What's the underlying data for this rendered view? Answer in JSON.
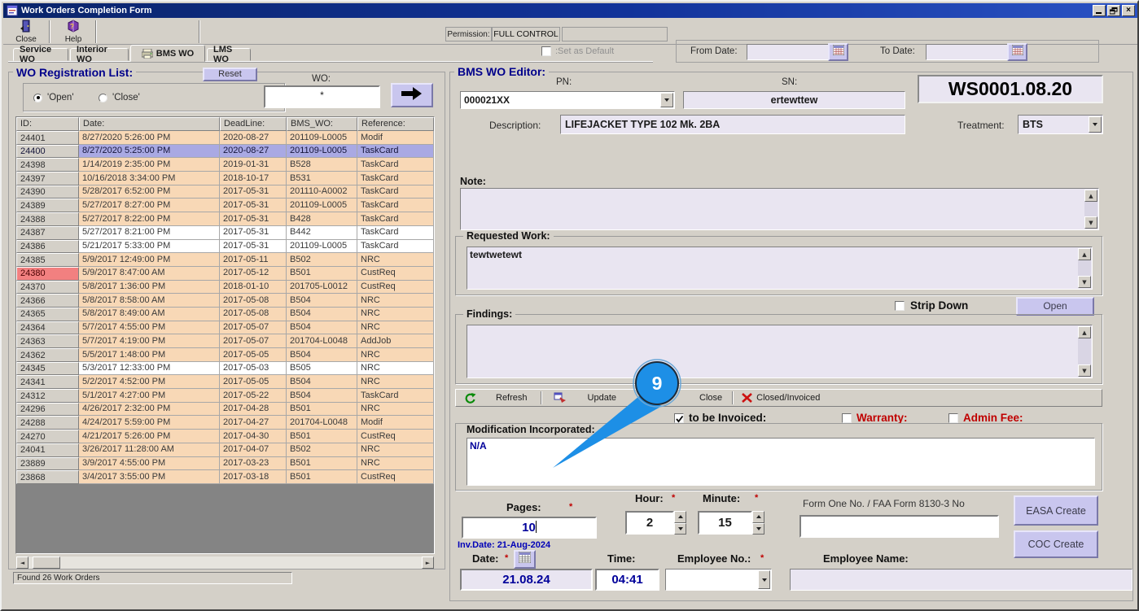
{
  "window": {
    "title": "Work Orders Completion Form",
    "minimize": "_",
    "restore": "",
    "close_x": "×"
  },
  "toolbar": {
    "close_label": "Close",
    "help_label": "Help",
    "permission_label": "Permission:",
    "permission_value": "FULL CONTROL"
  },
  "tabs": [
    {
      "label": "Service WO",
      "active": false
    },
    {
      "label": "Interior WO",
      "active": false
    },
    {
      "label": "BMS WO",
      "active": true
    },
    {
      "label": "LMS WO",
      "active": false
    }
  ],
  "set_as_default_label": ":Set as Default",
  "date_filter": {
    "from_label": "From Date:",
    "to_label": "To Date:",
    "from_value": "",
    "to_value": ""
  },
  "wo_list": {
    "title": "WO Registration List:",
    "reset_label": "Reset",
    "radio_open_label": "'Open'",
    "radio_close_label": "'Close'",
    "wo_label": "WO:",
    "wo_value": "*",
    "columns": [
      "ID:",
      "Date:",
      "DeadLine:",
      "BMS_WO:",
      "Reference:"
    ],
    "rows": [
      {
        "id": "24401",
        "date": "8/27/2020 5:26:00 PM",
        "deadline": "2020-08-27",
        "bms_wo": "201109-L0005",
        "reference": "Modif",
        "state": "peach"
      },
      {
        "id": "24400",
        "date": "8/27/2020 5:25:00 PM",
        "deadline": "2020-08-27",
        "bms_wo": "201109-L0005",
        "reference": "TaskCard",
        "state": "selected"
      },
      {
        "id": "24398",
        "date": "1/14/2019 2:35:00 PM",
        "deadline": "2019-01-31",
        "bms_wo": "B528",
        "reference": "TaskCard",
        "state": "peach"
      },
      {
        "id": "24397",
        "date": "10/16/2018 3:34:00 PM",
        "deadline": "2018-10-17",
        "bms_wo": "B531",
        "reference": "TaskCard",
        "state": "peach"
      },
      {
        "id": "24390",
        "date": "5/28/2017 6:52:00 PM",
        "deadline": "2017-05-31",
        "bms_wo": "201110-A0002",
        "reference": "TaskCard",
        "state": "peach"
      },
      {
        "id": "24389",
        "date": "5/27/2017 8:27:00 PM",
        "deadline": "2017-05-31",
        "bms_wo": "201109-L0005",
        "reference": "TaskCard",
        "state": "peach"
      },
      {
        "id": "24388",
        "date": "5/27/2017 8:22:00 PM",
        "deadline": "2017-05-31",
        "bms_wo": "B428",
        "reference": "TaskCard",
        "state": "peach"
      },
      {
        "id": "24387",
        "date": "5/27/2017 8:21:00 PM",
        "deadline": "2017-05-31",
        "bms_wo": "B442",
        "reference": "TaskCard",
        "state": "white"
      },
      {
        "id": "24386",
        "date": "5/21/2017 5:33:00 PM",
        "deadline": "2017-05-31",
        "bms_wo": "201109-L0005",
        "reference": "TaskCard",
        "state": "white"
      },
      {
        "id": "24385",
        "date": "5/9/2017 12:49:00 PM",
        "deadline": "2017-05-11",
        "bms_wo": "B502",
        "reference": "NRC",
        "state": "peach"
      },
      {
        "id": "24380",
        "date": "5/9/2017 8:47:00 AM",
        "deadline": "2017-05-12",
        "bms_wo": "B501",
        "reference": "CustReq",
        "state": "peach",
        "id_alert": true
      },
      {
        "id": "24370",
        "date": "5/8/2017 1:36:00 PM",
        "deadline": "2018-01-10",
        "bms_wo": "201705-L0012",
        "reference": "CustReq",
        "state": "peach"
      },
      {
        "id": "24366",
        "date": "5/8/2017 8:58:00 AM",
        "deadline": "2017-05-08",
        "bms_wo": "B504",
        "reference": "NRC",
        "state": "peach"
      },
      {
        "id": "24365",
        "date": "5/8/2017 8:49:00 AM",
        "deadline": "2017-05-08",
        "bms_wo": "B504",
        "reference": "NRC",
        "state": "peach"
      },
      {
        "id": "24364",
        "date": "5/7/2017 4:55:00 PM",
        "deadline": "2017-05-07",
        "bms_wo": "B504",
        "reference": "NRC",
        "state": "peach"
      },
      {
        "id": "24363",
        "date": "5/7/2017 4:19:00 PM",
        "deadline": "2017-05-07",
        "bms_wo": "201704-L0048",
        "reference": "AddJob",
        "state": "peach"
      },
      {
        "id": "24362",
        "date": "5/5/2017 1:48:00 PM",
        "deadline": "2017-05-05",
        "bms_wo": "B504",
        "reference": "NRC",
        "state": "peach"
      },
      {
        "id": "24345",
        "date": "5/3/2017 12:33:00 PM",
        "deadline": "2017-05-03",
        "bms_wo": "B505",
        "reference": "NRC",
        "state": "white"
      },
      {
        "id": "24341",
        "date": "5/2/2017 4:52:00 PM",
        "deadline": "2017-05-05",
        "bms_wo": "B504",
        "reference": "NRC",
        "state": "peach"
      },
      {
        "id": "24312",
        "date": "5/1/2017 4:27:00 PM",
        "deadline": "2017-05-22",
        "bms_wo": "B504",
        "reference": "TaskCard",
        "state": "peach"
      },
      {
        "id": "24296",
        "date": "4/26/2017 2:32:00 PM",
        "deadline": "2017-04-28",
        "bms_wo": "B501",
        "reference": "NRC",
        "state": "peach"
      },
      {
        "id": "24288",
        "date": "4/24/2017 5:59:00 PM",
        "deadline": "2017-04-27",
        "bms_wo": "201704-L0048",
        "reference": "Modif",
        "state": "peach"
      },
      {
        "id": "24270",
        "date": "4/21/2017 5:26:00 PM",
        "deadline": "2017-04-30",
        "bms_wo": "B501",
        "reference": "CustReq",
        "state": "peach"
      },
      {
        "id": "24041",
        "date": "3/26/2017 11:28:00 AM",
        "deadline": "2017-04-07",
        "bms_wo": "B502",
        "reference": "NRC",
        "state": "peach"
      },
      {
        "id": "23889",
        "date": "3/9/2017 4:55:00 PM",
        "deadline": "2017-03-23",
        "bms_wo": "B501",
        "reference": "NRC",
        "state": "peach"
      },
      {
        "id": "23868",
        "date": "3/4/2017 3:55:00 PM",
        "deadline": "2017-03-18",
        "bms_wo": "B501",
        "reference": "CustReq",
        "state": "peach"
      }
    ],
    "status": "Found 26 Work Orders"
  },
  "editor": {
    "title": "BMS WO Editor:",
    "pn_label": "PN:",
    "pn_value": "000021XX",
    "sn_label": "SN:",
    "sn_value": "ertewttew",
    "ws_number": "WS0001.08.20",
    "description_label": "Description:",
    "description_value": "LIFEJACKET TYPE 102 Mk. 2BA",
    "treatment_label": "Treatment:",
    "treatment_value": "BTS",
    "note_label": "Note:",
    "note_value": "",
    "requested_label": "Requested Work:",
    "requested_value": "tewtwetewt",
    "strip_down_label": "Strip Down",
    "open_button_label": "Open",
    "findings_label": "Findings:",
    "findings_value": "",
    "actions": {
      "refresh": "Refresh",
      "update": "Update",
      "close": "Close",
      "closed_invoiced": "Closed/Invoiced"
    },
    "flags": {
      "invoiced_label": "to be Invoiced:",
      "invoiced_checked": true,
      "warranty_label": "Warranty:",
      "warranty_checked": false,
      "admin_fee_label": "Admin Fee:",
      "admin_fee_checked": false
    },
    "modification_label": "Modification Incorporated:",
    "modification_value": "N/A",
    "pages_label": "Pages:",
    "pages_value": "10",
    "inv_date_text": "Inv.Date: 21-Aug-2024",
    "hour_label": "Hour:",
    "hour_value": "2",
    "minute_label": "Minute:",
    "minute_value": "15",
    "form_one_label": "Form One No. / FAA Form 8130-3 No",
    "form_one_value": "",
    "easa_button_label": "EASA Create",
    "coc_button_label": "COC Create",
    "date_label": "Date:",
    "date_value": "21.08.24",
    "time_label": "Time:",
    "time_value": "04:41",
    "employee_no_label": "Employee No.:",
    "employee_no_value": "",
    "employee_name_label": "Employee Name:",
    "employee_name_value": ""
  },
  "callout": {
    "number": "9"
  },
  "colors": {
    "title_bar": "#0a246a",
    "window_face": "#d4d0c8",
    "row_peach": "#f8d8b6",
    "row_selected": "#a9a9e3",
    "id_alert": "#f28080",
    "button_purple": "#c9c6ee",
    "field_lavender": "#e9e5f1",
    "heading_blue": "#00008b",
    "label_red": "#c00000",
    "value_blue": "#00009a",
    "callout_blue": "#1d8fe6"
  }
}
